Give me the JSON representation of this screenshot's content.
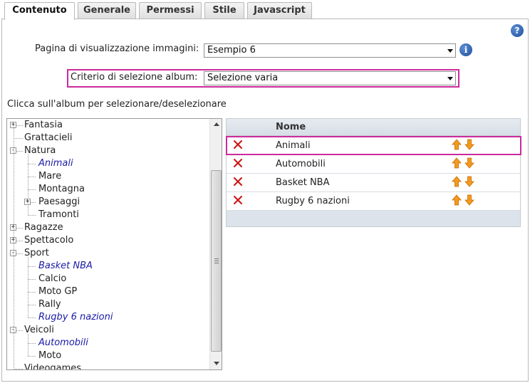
{
  "tabs": [
    {
      "label": "Contenuto",
      "active": true
    },
    {
      "label": "Generale",
      "active": false
    },
    {
      "label": "Permessi",
      "active": false
    },
    {
      "label": "Stile",
      "active": false
    },
    {
      "label": "Javascript",
      "active": false
    }
  ],
  "help_icon": "?",
  "info_icon": "i",
  "form": {
    "page_label": "Pagina di visualizzazione immagini:",
    "page_value": "Esempio 6",
    "criteria_label": "Criterio di selezione album:",
    "criteria_value": "Selezione varia",
    "instruction": "Clicca sull'album per selezionare/deselezionare"
  },
  "tree": [
    {
      "label": "Fantasia",
      "level": 0,
      "expander": "+",
      "selected": false
    },
    {
      "label": "Grattacieli",
      "level": 0,
      "expander": "",
      "selected": false
    },
    {
      "label": "Natura",
      "level": 0,
      "expander": "−",
      "selected": false
    },
    {
      "label": "Animali",
      "level": 1,
      "expander": "",
      "selected": true
    },
    {
      "label": "Mare",
      "level": 1,
      "expander": "",
      "selected": false
    },
    {
      "label": "Montagna",
      "level": 1,
      "expander": "",
      "selected": false
    },
    {
      "label": "Paesaggi",
      "level": 1,
      "expander": "+",
      "selected": false
    },
    {
      "label": "Tramonti",
      "level": 1,
      "expander": "",
      "selected": false
    },
    {
      "label": "Ragazze",
      "level": 0,
      "expander": "+",
      "selected": false
    },
    {
      "label": "Spettacolo",
      "level": 0,
      "expander": "+",
      "selected": false
    },
    {
      "label": "Sport",
      "level": 0,
      "expander": "−",
      "selected": false
    },
    {
      "label": "Basket NBA",
      "level": 1,
      "expander": "",
      "selected": true
    },
    {
      "label": "Calcio",
      "level": 1,
      "expander": "",
      "selected": false
    },
    {
      "label": "Moto GP",
      "level": 1,
      "expander": "",
      "selected": false
    },
    {
      "label": "Rally",
      "level": 1,
      "expander": "",
      "selected": false
    },
    {
      "label": "Rugby 6 nazioni",
      "level": 1,
      "expander": "",
      "selected": true
    },
    {
      "label": "Veicoli",
      "level": 0,
      "expander": "−",
      "selected": false
    },
    {
      "label": "Automobili",
      "level": 1,
      "expander": "",
      "selected": true
    },
    {
      "label": "Moto",
      "level": 1,
      "expander": "",
      "selected": false
    },
    {
      "label": "Videogames",
      "level": 0,
      "expander": "",
      "selected": false
    }
  ],
  "grid": {
    "header": "Nome",
    "rows": [
      "Animali",
      "Automobili",
      "Basket NBA",
      "Rugby 6 nazioni"
    ]
  },
  "colors": {
    "highlight": "#cc2a9c",
    "selected_text": "#1a1aa6",
    "delete_icon": "#cc1111",
    "arrow_icon": "#f39a1e"
  },
  "icons": {
    "delete": "delete-x-icon",
    "move_up": "arrow-up-icon",
    "move_down": "arrow-down-icon",
    "help": "help-icon",
    "info": "info-icon"
  }
}
